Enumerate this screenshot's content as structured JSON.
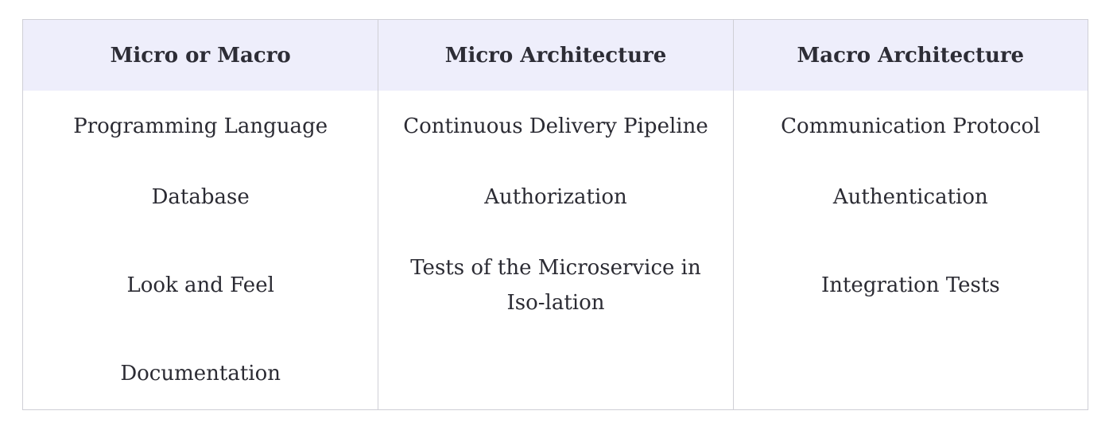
{
  "table": {
    "headers": [
      "Micro or Macro",
      "Micro Architecture",
      "Macro Architecture"
    ],
    "columns": [
      [
        "Programming Language",
        "Database",
        "Look and Feel",
        "Documentation"
      ],
      [
        "Continuous Delivery Pipeline",
        "Authorization",
        "Tests of the Microservice in Iso-lation"
      ],
      [
        "Communication Protocol",
        "Authentication",
        "Integration Tests"
      ]
    ]
  }
}
